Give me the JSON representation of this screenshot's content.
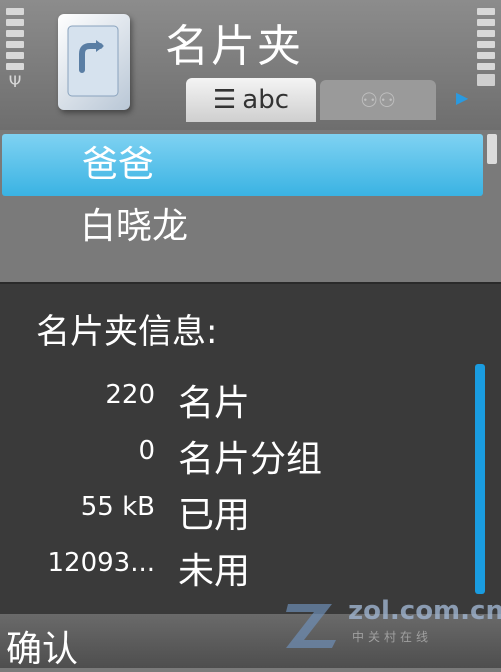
{
  "header": {
    "title": "名片夹",
    "tab_abc_label": "abc"
  },
  "list": {
    "items": [
      "爸爸",
      "白晓龙"
    ],
    "selected_index": 0
  },
  "info_popup": {
    "title": "名片夹信息:",
    "rows": [
      {
        "value": "220",
        "label": "名片"
      },
      {
        "value": "0",
        "label": "名片分组"
      },
      {
        "value": "55 kB",
        "label": "已用"
      },
      {
        "value": "12093...",
        "label": "未用"
      }
    ]
  },
  "softkeys": {
    "left": "确认"
  },
  "watermark": {
    "text": "zol.com.cn",
    "sub": "中关村在线"
  },
  "colors": {
    "accent": "#3ab3e3",
    "scrollbar": "#1a9ce0",
    "popup_bg": "#3a3a3a"
  }
}
